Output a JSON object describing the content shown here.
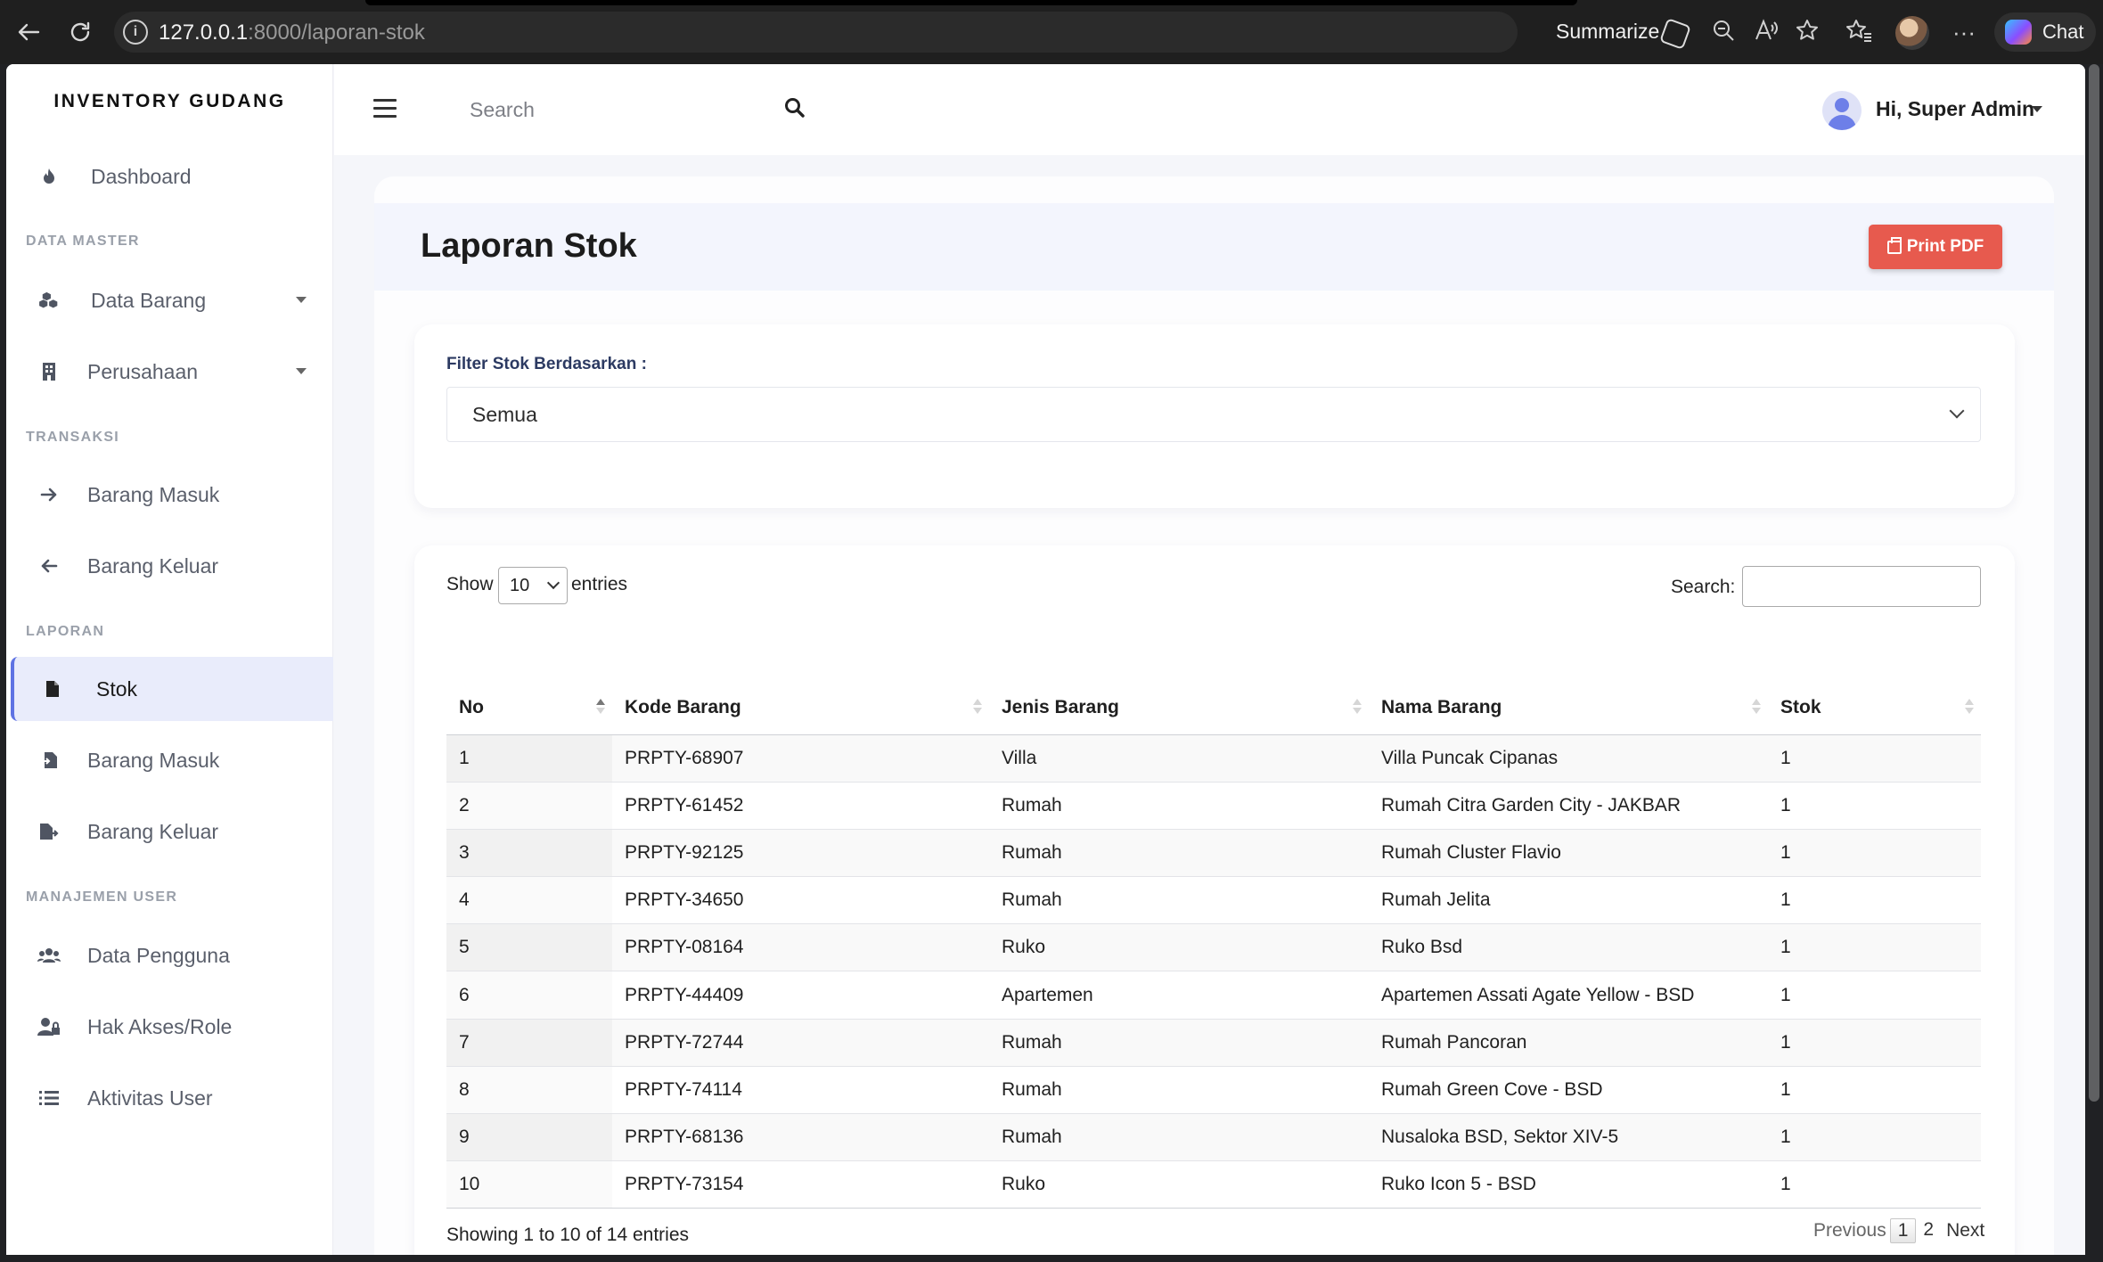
{
  "browser": {
    "url_host": "127.0.0.1",
    "url_path": ":8000/laporan-stok",
    "summarize_label": "Summarize",
    "chat_label": "Chat"
  },
  "sidebar": {
    "brand": "INVENTORY GUDANG",
    "dashboard": "Dashboard",
    "section_data_master": "DATA MASTER",
    "data_barang": "Data Barang",
    "perusahaan": "Perusahaan",
    "section_transaksi": "TRANSAKSI",
    "barang_masuk": "Barang Masuk",
    "barang_keluar": "Barang Keluar",
    "section_laporan": "LAPORAN",
    "stok": "Stok",
    "lap_barang_masuk": "Barang Masuk",
    "lap_barang_keluar": "Barang Keluar",
    "section_manajemen_user": "MANAJEMEN USER",
    "data_pengguna": "Data Pengguna",
    "hak_akses": "Hak Akses/Role",
    "aktivitas_user": "Aktivitas User"
  },
  "topbar": {
    "search_placeholder": "Search",
    "user_greeting": "Hi, Super Admin"
  },
  "main": {
    "title": "Laporan Stok",
    "print_label": "Print PDF",
    "filter_label": "Filter Stok Berdasarkan :",
    "filter_value": "Semua",
    "show_label": "Show",
    "page_length": "10",
    "entries_label": "entries",
    "search_label": "Search:",
    "info": "Showing 1 to 10 of 14 entries",
    "pager": {
      "previous": "Previous",
      "page1": "1",
      "page2": "2",
      "next": "Next"
    }
  },
  "table": {
    "headers": [
      "No",
      "Kode Barang",
      "Jenis Barang",
      "Nama Barang",
      "Stok"
    ],
    "rows": [
      [
        "1",
        "PRPTY-68907",
        "Villa",
        "Villa Puncak Cipanas",
        "1"
      ],
      [
        "2",
        "PRPTY-61452",
        "Rumah",
        "Rumah Citra Garden City - JAKBAR",
        "1"
      ],
      [
        "3",
        "PRPTY-92125",
        "Rumah",
        "Rumah Cluster Flavio",
        "1"
      ],
      [
        "4",
        "PRPTY-34650",
        "Rumah",
        "Rumah Jelita",
        "1"
      ],
      [
        "5",
        "PRPTY-08164",
        "Ruko",
        "Ruko Bsd",
        "1"
      ],
      [
        "6",
        "PRPTY-44409",
        "Apartemen",
        "Apartemen Assati Agate Yellow - BSD",
        "1"
      ],
      [
        "7",
        "PRPTY-72744",
        "Rumah",
        "Rumah Pancoran",
        "1"
      ],
      [
        "8",
        "PRPTY-74114",
        "Rumah",
        "Rumah Green Cove - BSD",
        "1"
      ],
      [
        "9",
        "PRPTY-68136",
        "Rumah",
        "Nusaloka BSD, Sektor XIV-5",
        "1"
      ],
      [
        "10",
        "PRPTY-73154",
        "Ruko",
        "Ruko Icon 5 - BSD",
        "1"
      ]
    ]
  },
  "colors": {
    "accent": "#5f73e3",
    "print_button": "#e75a4e",
    "active_bg": "#e9ecfb"
  },
  "icons": {
    "dashboard": "fire-icon",
    "data_barang": "cubes-icon",
    "perusahaan": "building-icon",
    "barang_masuk": "arrow-right-icon",
    "barang_keluar": "arrow-left-icon",
    "stok": "file-icon",
    "lap_barang_masuk": "file-import-icon",
    "lap_barang_keluar": "file-export-icon",
    "data_pengguna": "users-icon",
    "hak_akses": "user-lock-icon",
    "aktivitas_user": "list-icon"
  }
}
